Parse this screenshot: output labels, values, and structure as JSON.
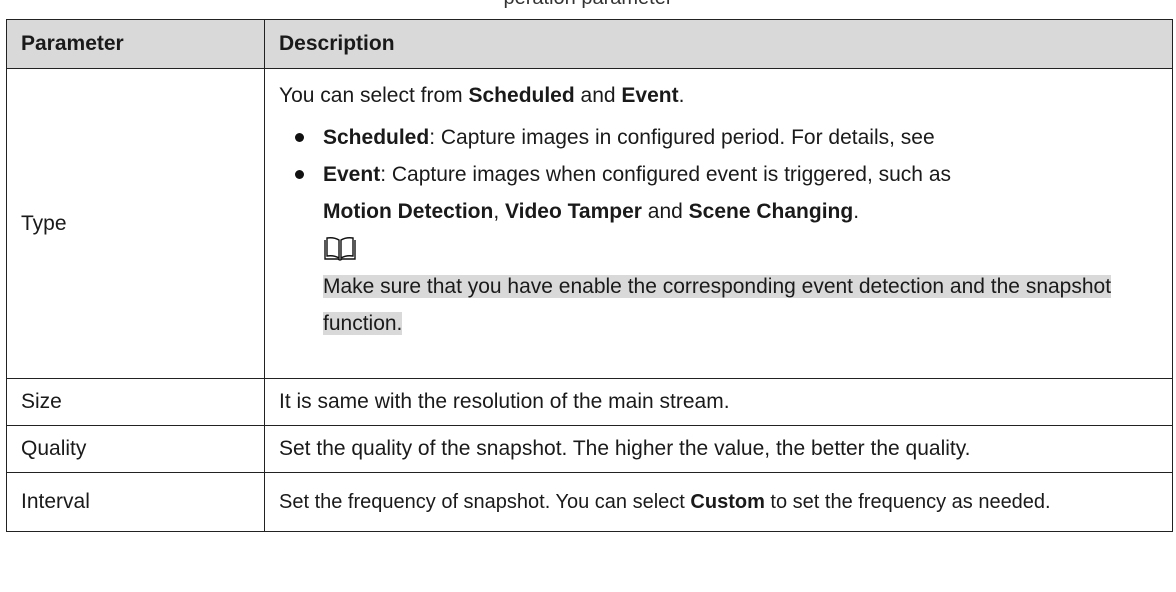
{
  "page_fragment": "peration parameter",
  "table": {
    "headers": [
      "Parameter",
      "Description"
    ],
    "rows": {
      "type": {
        "name": "Type",
        "intro": [
          "You can select from ",
          "Scheduled",
          " and ",
          "Event",
          "."
        ],
        "bullets": [
          {
            "term": "Scheduled",
            "text": ": Capture images in configured period. For details, see"
          },
          {
            "term": "Event",
            "text": ": Capture images when configured event is triggered, such as",
            "examples": [
              "Motion Detection",
              ", ",
              "Video Tamper",
              " and ",
              "Scene Changing",
              "."
            ]
          }
        ],
        "note_icon": "book-note-icon",
        "note": "Make sure that you have enable the corresponding event detection and the snapshot function."
      },
      "size": {
        "name": "Size",
        "desc": "It is same with the resolution of the main stream."
      },
      "quality": {
        "name": "Quality",
        "desc": "Set the quality of the snapshot. The higher the value, the better the quality."
      },
      "interval": {
        "name": "Interval",
        "desc_parts": [
          "Set the frequency of snapshot. You can select ",
          "Custom",
          " to set the frequency as needed."
        ]
      }
    }
  },
  "colors": {
    "header_bg": "#d9d9d9",
    "note_highlight": "#d9d9d9",
    "border": "#222222"
  }
}
